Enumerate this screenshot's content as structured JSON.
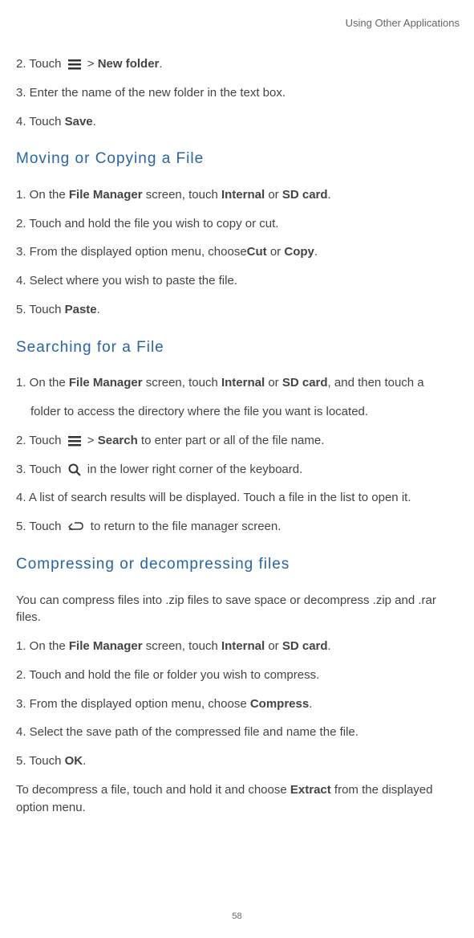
{
  "header": "Using Other Applications",
  "topSteps": {
    "s2_pre": "2. Touch ",
    "s2_mid": " > ",
    "s2_bold": "New folder",
    "s2_post": ".",
    "s3": "3. Enter the name of the new folder in the text box.",
    "s4_pre": "4. Touch ",
    "s4_bold": "Save",
    "s4_post": "."
  },
  "heading1": "Moving or Copying a File",
  "moving": {
    "s1_pre": "1. On the ",
    "s1_b1": "File Manager",
    "s1_mid1": " screen, touch ",
    "s1_b2": "Internal",
    "s1_mid2": " or ",
    "s1_b3": "SD card",
    "s1_post": ".",
    "s2": "2. Touch and hold the file you wish to copy or cut.",
    "s3_pre": "3. From the displayed option menu, choose",
    "s3_b1": "Cut",
    "s3_mid": " or ",
    "s3_b2": "Copy",
    "s3_post": ".",
    "s4": "4. Select where you wish to paste the file.",
    "s5_pre": "5. Touch ",
    "s5_b": "Paste",
    "s5_post": "."
  },
  "heading2": "Searching for a File",
  "searching": {
    "s1_pre": "1. On the ",
    "s1_b1": "File Manager",
    "s1_mid1": " screen, touch ",
    "s1_b2": "Internal",
    "s1_mid2": " or ",
    "s1_b3": "SD card",
    "s1_post": ", and then touch a",
    "s1_line2": "folder to access the directory where the file you want is located.",
    "s2_pre": "2. Touch ",
    "s2_mid": " > ",
    "s2_b": "Search",
    "s2_post": " to enter part or all of the file name.",
    "s3_pre": "3. Touch ",
    "s3_post": " in the lower right corner of the keyboard.",
    "s4": "4. A list of search results will be displayed. Touch a file in the list to open it.",
    "s5_pre": "5. Touch ",
    "s5_post": " to return to the file manager screen."
  },
  "heading3": "Compressing or decompressing files",
  "compress": {
    "intro": "You can compress files into .zip files to save space or decompress .zip and .rar files.",
    "s1_pre": "1. On the ",
    "s1_b1": "File Manager",
    "s1_mid1": " screen, touch ",
    "s1_b2": "Internal",
    "s1_mid2": " or ",
    "s1_b3": "SD card",
    "s1_post": ".",
    "s2": "2. Touch and hold the file or folder you wish to compress.",
    "s3_pre": "3. From the displayed option menu, choose ",
    "s3_b": "Compress",
    "s3_post": ".",
    "s4": "4. Select the save path of the compressed file and name the file.",
    "s5_pre": "5. Touch ",
    "s5_b": "OK",
    "s5_post": ".",
    "decompress_pre": " To decompress a file, touch and hold it and choose ",
    "decompress_b": "Extract",
    "decompress_post": " from the displayed option menu."
  },
  "pageNumber": "58"
}
